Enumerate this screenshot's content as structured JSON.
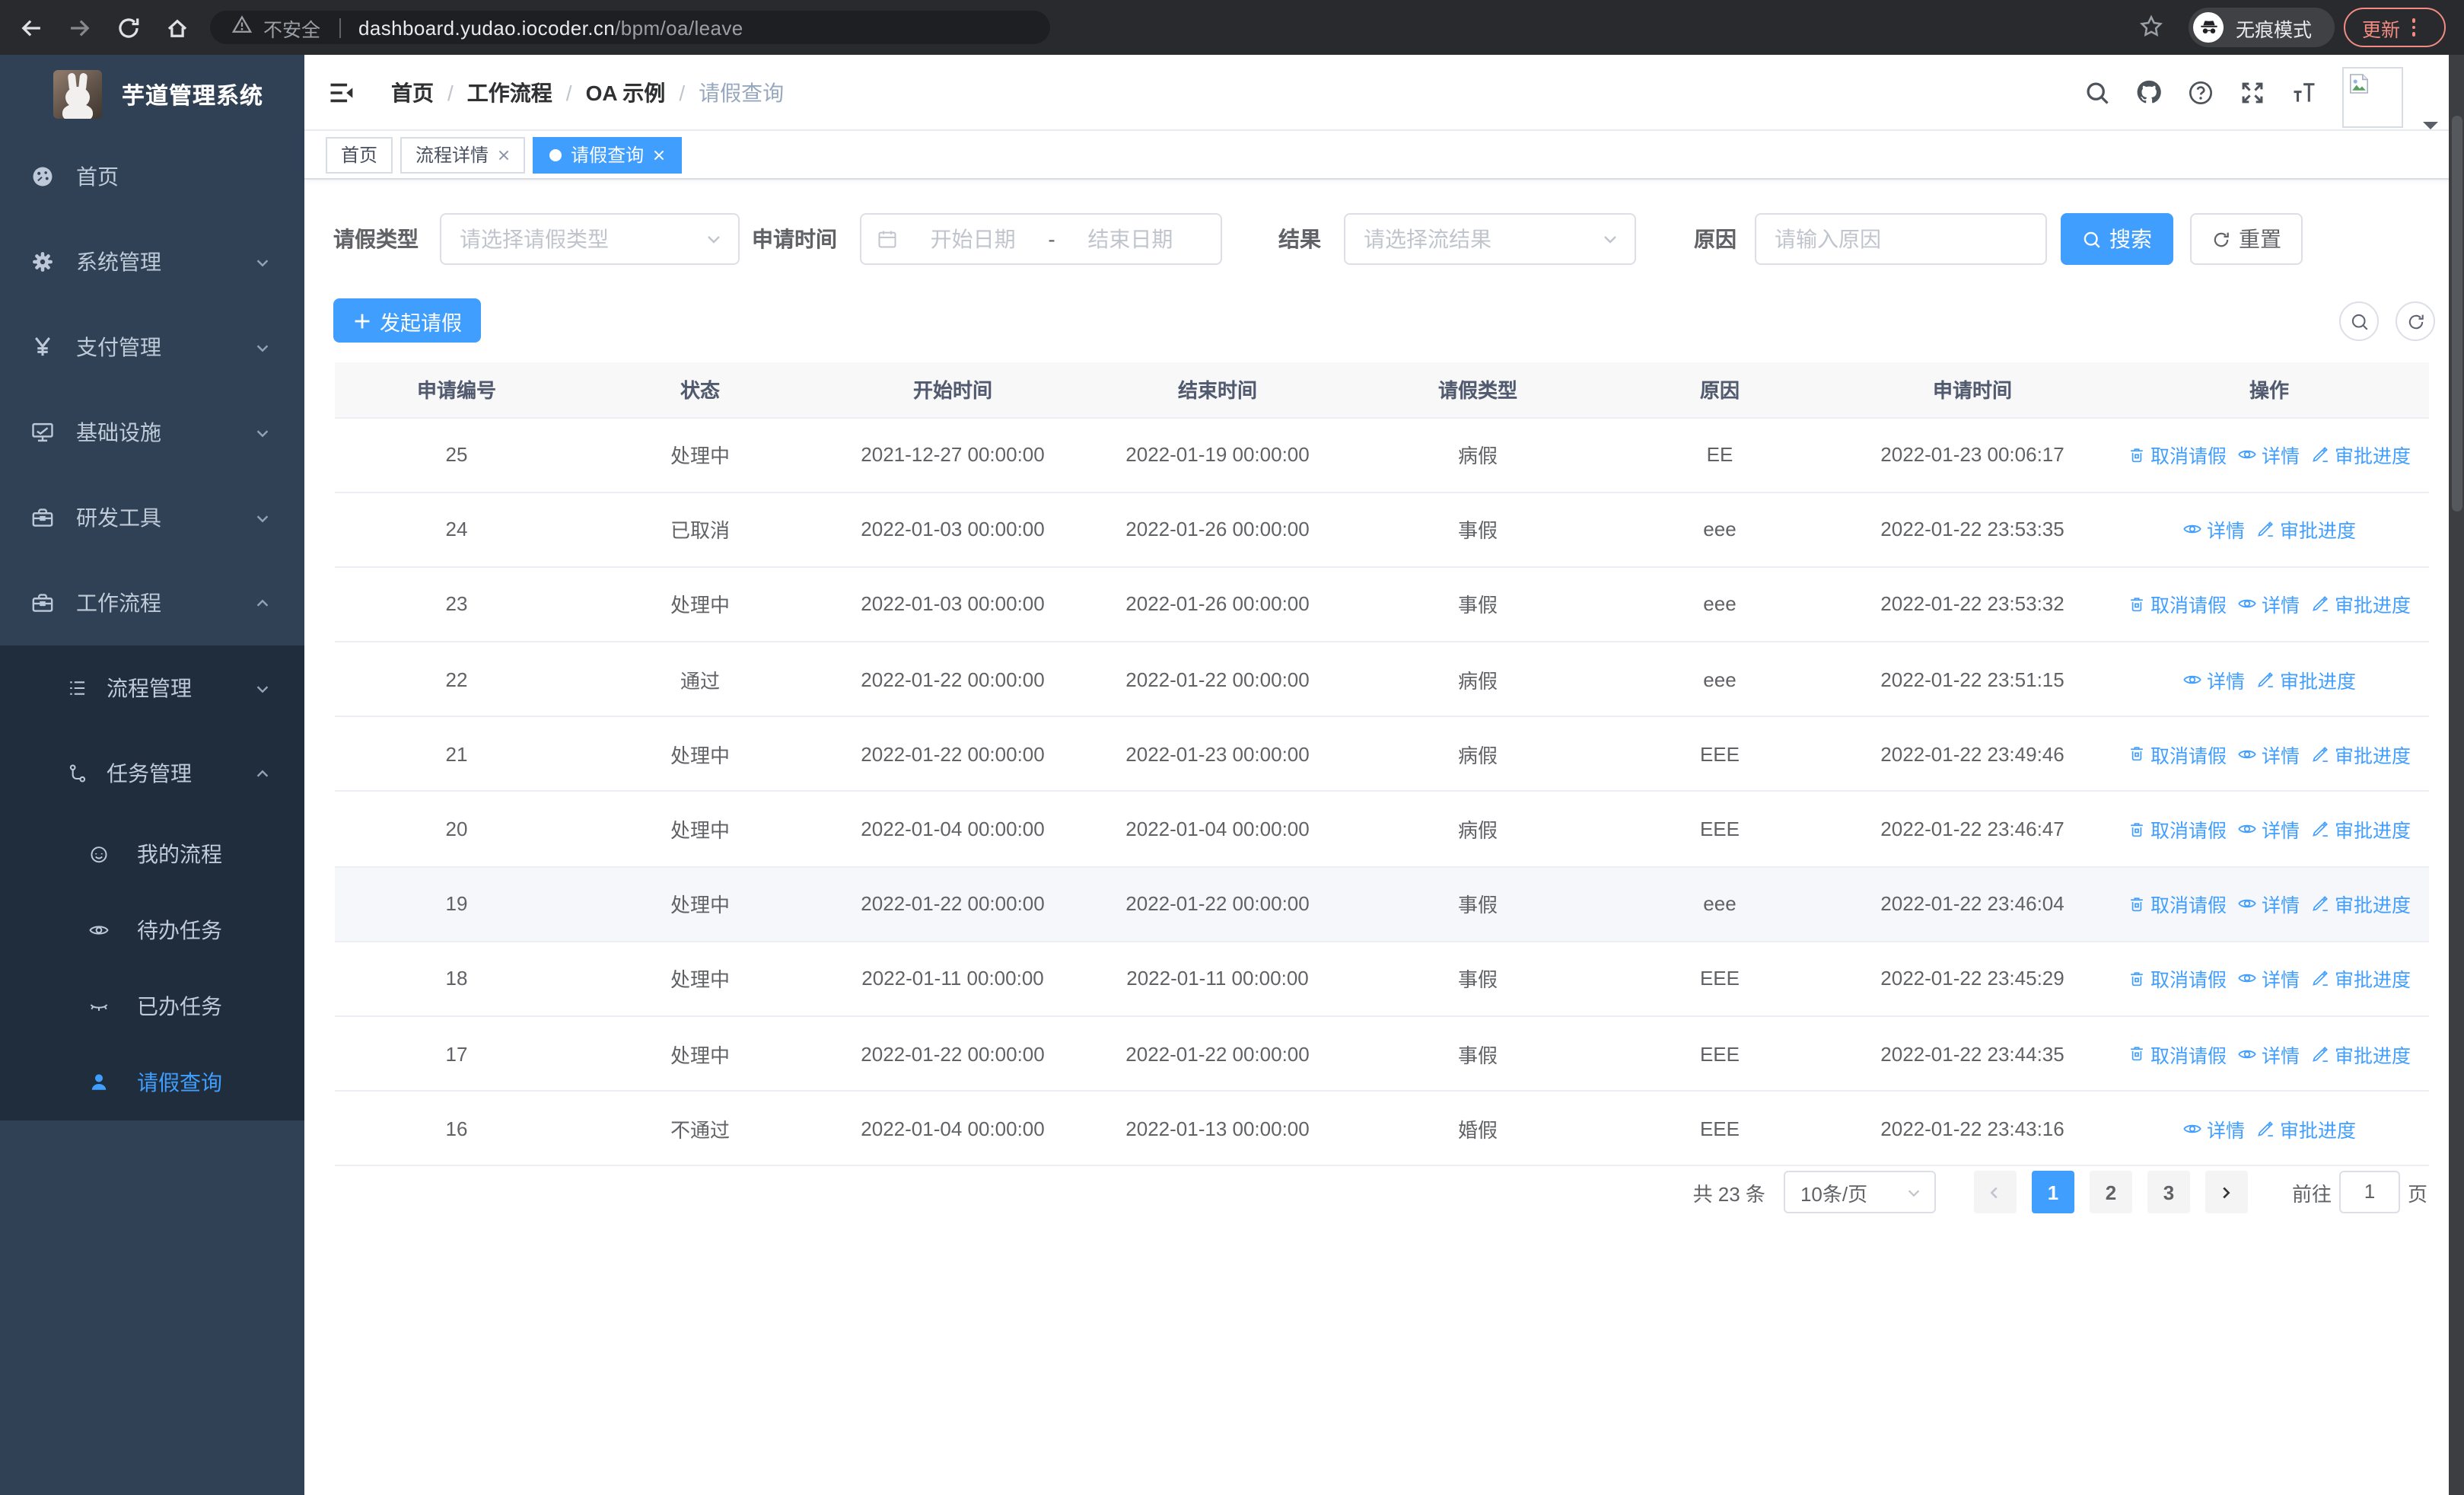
{
  "colors": {
    "accent": "#409eff",
    "sidebar_bg": "#304156",
    "submenu_bg": "#1f2d3d",
    "update_red": "#f28b82"
  },
  "browser": {
    "insecure_label": "不安全",
    "url_host": "dashboard.yudao.iocoder.cn",
    "url_path": "/bpm/oa/leave",
    "incognito_label": "无痕模式",
    "update_label": "更新"
  },
  "sidebar": {
    "title": "芋道管理系统",
    "menu": [
      {
        "label": "首页",
        "icon": "dashboard-icon"
      },
      {
        "label": "系统管理",
        "icon": "gear-icon"
      },
      {
        "label": "支付管理",
        "icon": "yen-icon"
      },
      {
        "label": "基础设施",
        "icon": "monitor-icon"
      },
      {
        "label": "研发工具",
        "icon": "toolbox-icon"
      },
      {
        "label": "工作流程",
        "icon": "briefcase-icon"
      },
      {
        "label": "流程管理",
        "icon": "list-icon"
      },
      {
        "label": "任务管理",
        "icon": "flow-icon"
      },
      {
        "label": "我的流程",
        "icon": "face-icon"
      },
      {
        "label": "待办任务",
        "icon": "eye-open-icon"
      },
      {
        "label": "已办任务",
        "icon": "eye-closed-icon"
      },
      {
        "label": "请假查询",
        "icon": "user-icon"
      }
    ]
  },
  "breadcrumb": [
    "首页",
    "工作流程",
    "OA 示例",
    "请假查询"
  ],
  "tabs": [
    {
      "label": "首页",
      "closable": false,
      "active": false
    },
    {
      "label": "流程详情",
      "closable": true,
      "active": false
    },
    {
      "label": "请假查询",
      "closable": true,
      "active": true
    }
  ],
  "filters": {
    "leave_type_label": "请假类型",
    "leave_type_placeholder": "请选择请假类型",
    "apply_time_label": "申请时间",
    "start_placeholder": "开始日期",
    "range_separator": "-",
    "end_placeholder": "结束日期",
    "result_label": "结果",
    "result_placeholder": "请选择流结果",
    "reason_label": "原因",
    "reason_placeholder": "请输入原因",
    "search_label": "搜索",
    "reset_label": "重置"
  },
  "toolbar": {
    "create_label": "发起请假"
  },
  "table": {
    "columns": [
      "申请编号",
      "状态",
      "开始时间",
      "结束时间",
      "请假类型",
      "原因",
      "申请时间",
      "操作"
    ],
    "col_keys": [
      "id",
      "status",
      "start",
      "end",
      "type",
      "reason",
      "applied"
    ],
    "op_labels": {
      "cancel": "取消请假",
      "detail": "详情",
      "progress": "审批进度"
    },
    "hover_row_id": "19",
    "rows": [
      {
        "id": "25",
        "status": "处理中",
        "start": "2021-12-27 00:00:00",
        "end": "2022-01-19 00:00:00",
        "type": "病假",
        "reason": "EE",
        "applied": "2022-01-23 00:06:17",
        "ops": [
          "cancel",
          "detail",
          "progress"
        ]
      },
      {
        "id": "24",
        "status": "已取消",
        "start": "2022-01-03 00:00:00",
        "end": "2022-01-26 00:00:00",
        "type": "事假",
        "reason": "eee",
        "applied": "2022-01-22 23:53:35",
        "ops": [
          "detail",
          "progress"
        ]
      },
      {
        "id": "23",
        "status": "处理中",
        "start": "2022-01-03 00:00:00",
        "end": "2022-01-26 00:00:00",
        "type": "事假",
        "reason": "eee",
        "applied": "2022-01-22 23:53:32",
        "ops": [
          "cancel",
          "detail",
          "progress"
        ]
      },
      {
        "id": "22",
        "status": "通过",
        "start": "2022-01-22 00:00:00",
        "end": "2022-01-22 00:00:00",
        "type": "病假",
        "reason": "eee",
        "applied": "2022-01-22 23:51:15",
        "ops": [
          "detail",
          "progress"
        ]
      },
      {
        "id": "21",
        "status": "处理中",
        "start": "2022-01-22 00:00:00",
        "end": "2022-01-23 00:00:00",
        "type": "病假",
        "reason": "EEE",
        "applied": "2022-01-22 23:49:46",
        "ops": [
          "cancel",
          "detail",
          "progress"
        ]
      },
      {
        "id": "20",
        "status": "处理中",
        "start": "2022-01-04 00:00:00",
        "end": "2022-01-04 00:00:00",
        "type": "病假",
        "reason": "EEE",
        "applied": "2022-01-22 23:46:47",
        "ops": [
          "cancel",
          "detail",
          "progress"
        ]
      },
      {
        "id": "19",
        "status": "处理中",
        "start": "2022-01-22 00:00:00",
        "end": "2022-01-22 00:00:00",
        "type": "事假",
        "reason": "eee",
        "applied": "2022-01-22 23:46:04",
        "ops": [
          "cancel",
          "detail",
          "progress"
        ]
      },
      {
        "id": "18",
        "status": "处理中",
        "start": "2022-01-11 00:00:00",
        "end": "2022-01-11 00:00:00",
        "type": "事假",
        "reason": "EEE",
        "applied": "2022-01-22 23:45:29",
        "ops": [
          "cancel",
          "detail",
          "progress"
        ]
      },
      {
        "id": "17",
        "status": "处理中",
        "start": "2022-01-22 00:00:00",
        "end": "2022-01-22 00:00:00",
        "type": "事假",
        "reason": "EEE",
        "applied": "2022-01-22 23:44:35",
        "ops": [
          "cancel",
          "detail",
          "progress"
        ]
      },
      {
        "id": "16",
        "status": "不通过",
        "start": "2022-01-04 00:00:00",
        "end": "2022-01-13 00:00:00",
        "type": "婚假",
        "reason": "EEE",
        "applied": "2022-01-22 23:43:16",
        "ops": [
          "detail",
          "progress"
        ]
      }
    ]
  },
  "pagination": {
    "total_label": "共 23 条",
    "page_size": "10条/页",
    "pages": [
      "1",
      "2",
      "3"
    ],
    "active_page": "1",
    "goto_label": "前往",
    "goto_value": "1",
    "goto_suffix": "页"
  },
  "icons": {
    "trash-icon": "trash outline",
    "view-icon": "eye outline",
    "edit-icon": "pen",
    "search-icon": "magnifier",
    "refresh-icon": "circular arrow",
    "github-icon": "octocat",
    "help-icon": "question circle",
    "fullscreen-icon": "expand arrows",
    "font-size-icon": "tT",
    "incognito-icon": "hat and glasses",
    "broken-image-icon": "placeholder image"
  }
}
